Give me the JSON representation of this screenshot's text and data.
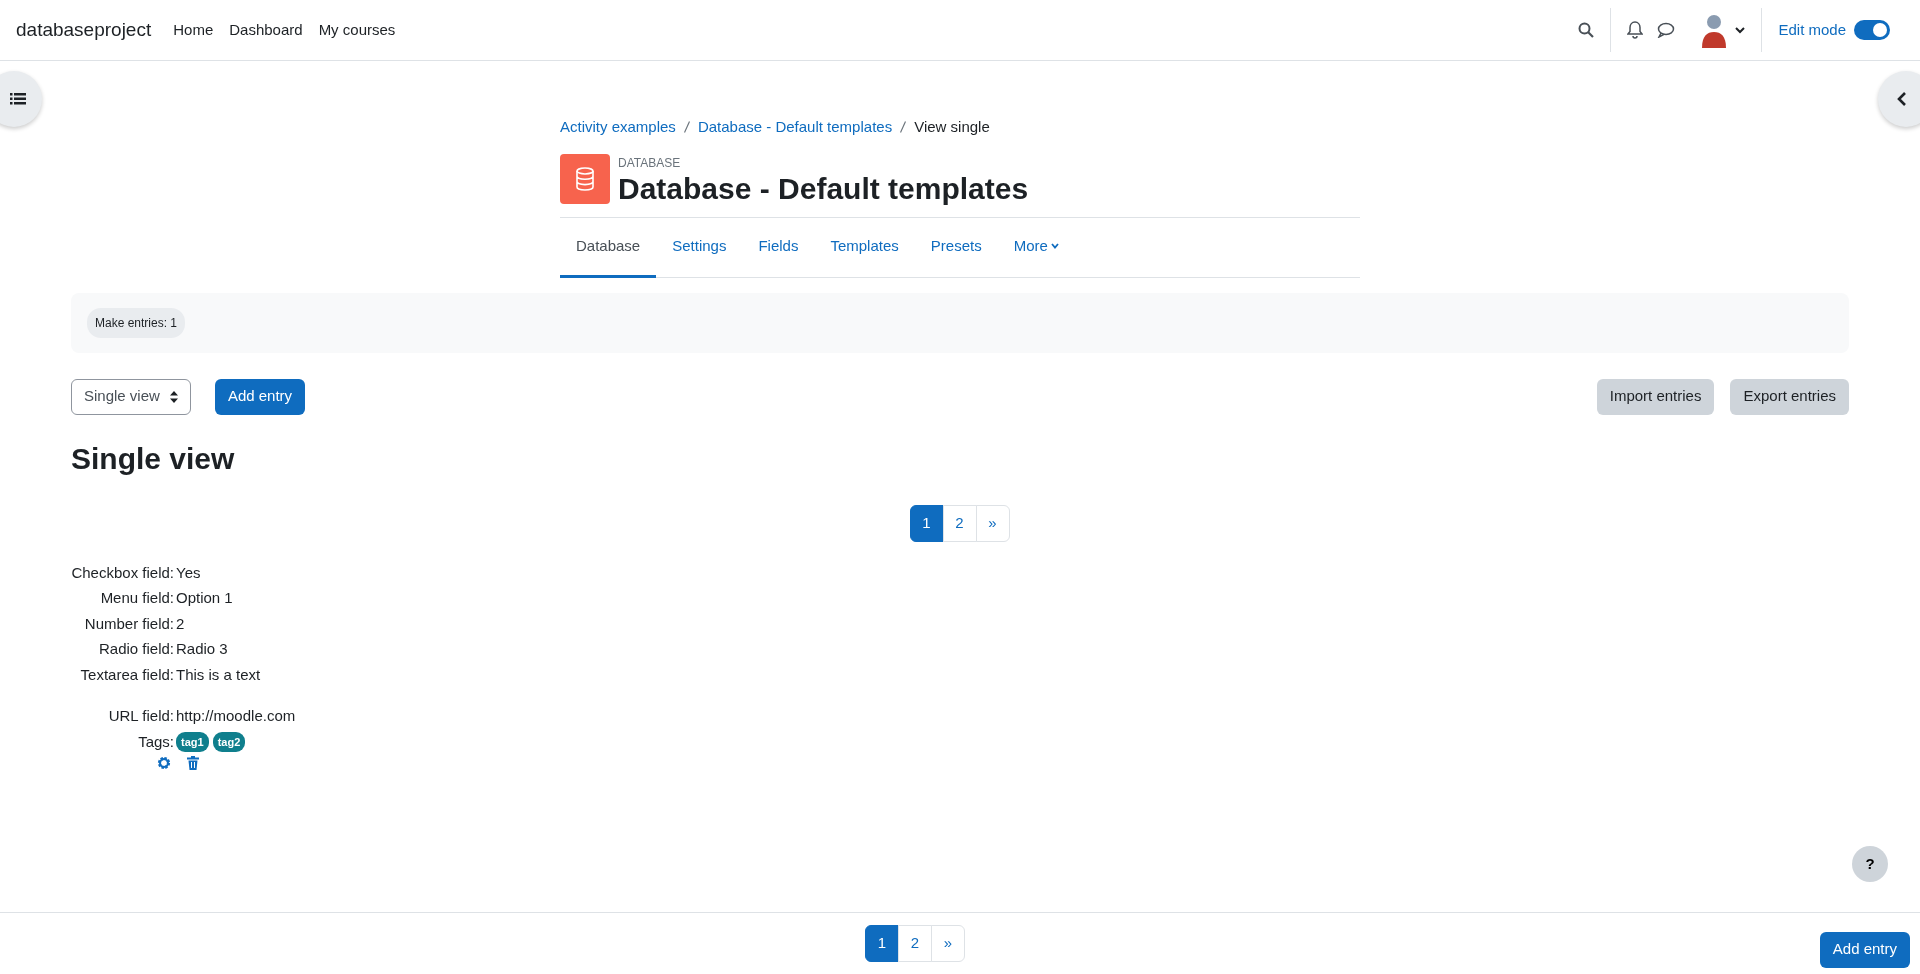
{
  "navbar": {
    "brand": "databaseproject",
    "links": [
      "Home",
      "Dashboard",
      "My courses"
    ],
    "edit_mode": {
      "label": "Edit mode",
      "on": true
    }
  },
  "breadcrumb": [
    {
      "label": "Activity examples",
      "kind": "link"
    },
    {
      "label": "Database - Default templates",
      "kind": "link"
    },
    {
      "label": "View single",
      "kind": "current"
    }
  ],
  "activity": {
    "type_label": "DATABASE",
    "title": "Database - Default templates"
  },
  "tabs": [
    {
      "label": "Database",
      "selected": true,
      "kind": "link"
    },
    {
      "label": "Settings",
      "selected": false,
      "kind": "link"
    },
    {
      "label": "Fields",
      "selected": false,
      "kind": "link"
    },
    {
      "label": "Templates",
      "selected": false,
      "kind": "link"
    },
    {
      "label": "Presets",
      "selected": false,
      "kind": "link"
    },
    {
      "label": "More",
      "selected": false,
      "kind": "dropdown"
    }
  ],
  "completion": {
    "label": "Make entries: 1"
  },
  "toolbar": {
    "view_select": "Single view",
    "add_button": "Add entry",
    "right_buttons": [
      "Import entries",
      "Export entries"
    ]
  },
  "heading": "Single view",
  "pagination": [
    {
      "label": "1",
      "selected": true
    },
    {
      "label": "2",
      "selected": false
    },
    {
      "label": "»",
      "selected": false
    }
  ],
  "fields": [
    {
      "label": "Checkbox field:",
      "value": "Yes",
      "kind": "text"
    },
    {
      "label": "Menu field:",
      "value": "Option 1",
      "kind": "text"
    },
    {
      "label": "Number field:",
      "value": "2",
      "kind": "text"
    },
    {
      "label": "Radio field:",
      "value": "Radio 3",
      "kind": "text"
    },
    {
      "label": "Textarea field:",
      "value": "This is a text",
      "kind": "textarea"
    },
    {
      "label": "URL field:",
      "value": "http://moodle.com",
      "kind": "text"
    },
    {
      "label": "Tags:",
      "tags": [
        "tag1",
        "tag2"
      ],
      "kind": "tags"
    }
  ],
  "help_button": "?",
  "footer": {
    "pagination": [
      {
        "label": "1",
        "selected": true
      },
      {
        "label": "2",
        "selected": false
      },
      {
        "label": "»",
        "selected": false
      }
    ],
    "add_button": "Add entry"
  }
}
